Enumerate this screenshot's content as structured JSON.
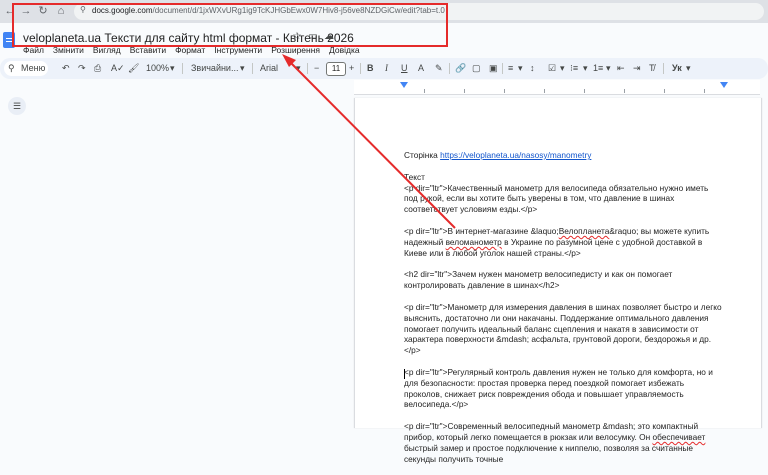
{
  "browser": {
    "url_host": "docs.google.com",
    "url_path": "/document/d/1jxWXvURg1ig9TcKJHGbEwx0W7Hiv8-j56ve8NZDGiCw/edit?tab=t.0"
  },
  "doc": {
    "title": "veloplaneta.ua Тексти для сайту html формат - Квітень 2026"
  },
  "menus": [
    "Файл",
    "Змінити",
    "Вигляд",
    "Вставити",
    "Формат",
    "Інструменти",
    "Розширення",
    "Довідка"
  ],
  "toolbar": {
    "menu_label": "Меню",
    "zoom": "100%",
    "style": "Звичайни...",
    "font": "Arial",
    "font_size": "11",
    "mode": "Ук"
  },
  "content": {
    "page_label": "Сторінка",
    "page_link": "https://veloplaneta.ua/nasosy/manometry",
    "text_label": "Текст",
    "p1": "<p dir=\"ltr\">Качественный манометр для велосипеда обязательно нужно иметь под рукой, если вы хотите быть уверены в том, что давление в шинах соответствует условиям езды.</p>",
    "p2_a": "<p dir=\"ltr\">В интернет-магазине &laquo;",
    "p2_u1": "Велопланета",
    "p2_b": "&raquo; вы можете купить надежный ",
    "p2_u2": "веломанометр",
    "p2_c": " в Украине по разумной цене с удобной доставкой в Киеве или в любой уголок нашей страны.</p>",
    "h2": "<h2 dir=\"ltr\">Зачем нужен манометр велосипедисту и как он помогает контролировать давление в шинах</h2>",
    "p3": "<p dir=\"ltr\">Манометр для измерения давления в шинах позволяет быстро и легко выяснить, достаточно ли они накачаны. Поддержание оптимального давления помогает получить идеальный баланс сцепления и накатя в зависимости от характера поверхности &mdash; асфальта, грунтовой дороги, бездорожья и др.</p>",
    "p4": "<p dir=\"ltr\">Регулярный контроль давления нужен не только для комфорта, но и для безопасности: простая проверка перед поездкой помогает избежать проколов, снижает риск повреждения обода и повышает управляемость велосипеда.</p>",
    "p5_a": "<p dir=\"ltr\">Современный велосипедный манометр &mdash; это компактный прибор, который легко помещается в рюкзак или велосумку. Он ",
    "p5_u": "обеспечивает",
    "p5_b": " быстрый замер и простое подключение к ниппелю, позволяя за считанные секунды получить точные"
  },
  "colors": {
    "annotation": "#e52b2b",
    "link": "#1155cc",
    "toolbar_bg": "#edf2fa"
  }
}
